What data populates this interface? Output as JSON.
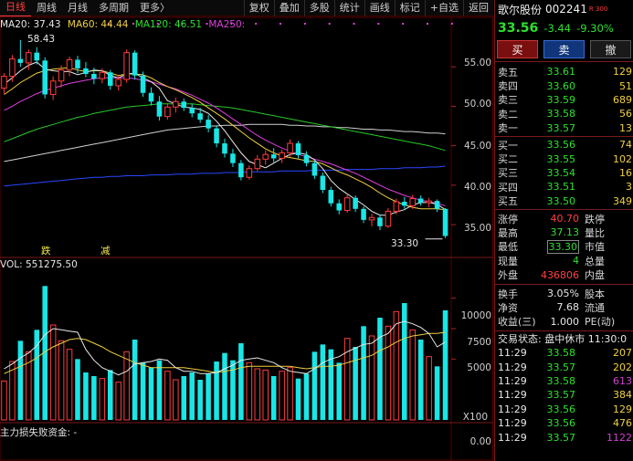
{
  "toolbar": {
    "tabs": [
      "日线",
      "周线",
      "月线",
      "多周期",
      "更多"
    ],
    "more_arrow": "〉",
    "tools": [
      "复权",
      "叠加",
      "多股",
      "统计",
      "画线",
      "标记",
      "+自选",
      "返回"
    ]
  },
  "legend": {
    "ma20": "MA20: 37.43",
    "ma60": "MA60: 44.44",
    "ma120": "MA120: 46.51",
    "ma250": "MA250: 42.42"
  },
  "colors": {
    "up": "#ff3c3c",
    "down": "#19e6e6",
    "ma5": "#e8e8e8",
    "ma10": "#f0d040",
    "ma20": "#e040e0",
    "ma60": "#28c828",
    "ma120": "#d0d0d0",
    "ma250": "#2848ff",
    "grid": "#5a0000"
  },
  "price_axis": {
    "labels": [
      "55.00",
      "50.00",
      "45.00",
      "40.00",
      "35.00"
    ]
  },
  "volume_axis": {
    "labels": [
      "10000",
      "7500",
      "5000"
    ],
    "unit": "X100"
  },
  "funds_axis": {
    "labels": [
      "0.00"
    ]
  },
  "annotations": {
    "high": "58.43",
    "low": "33.30",
    "mark1": "跌",
    "mark2": "减"
  },
  "volume_legend": "VOL: 551275.50",
  "funds_label": "主力损失败资金: -",
  "chart_data": {
    "type": "candlestick",
    "ylim": [
      32,
      60
    ],
    "candles": [
      {
        "o": 52.3,
        "h": 54.2,
        "l": 51.6,
        "c": 53.8
      },
      {
        "o": 53.8,
        "h": 56.5,
        "l": 53.1,
        "c": 56.0
      },
      {
        "o": 56.0,
        "h": 58.4,
        "l": 55.0,
        "c": 55.5
      },
      {
        "o": 55.5,
        "h": 57.2,
        "l": 54.6,
        "c": 56.8
      },
      {
        "o": 56.8,
        "h": 57.5,
        "l": 55.3,
        "c": 55.8
      },
      {
        "o": 55.8,
        "h": 56.2,
        "l": 51.0,
        "c": 51.5
      },
      {
        "o": 51.5,
        "h": 53.8,
        "l": 50.8,
        "c": 53.2
      },
      {
        "o": 53.2,
        "h": 55.2,
        "l": 52.4,
        "c": 54.6
      },
      {
        "o": 54.6,
        "h": 56.3,
        "l": 53.8,
        "c": 55.9
      },
      {
        "o": 55.9,
        "h": 56.4,
        "l": 54.2,
        "c": 54.8
      },
      {
        "o": 54.8,
        "h": 55.6,
        "l": 53.7,
        "c": 54.1
      },
      {
        "o": 54.1,
        "h": 54.9,
        "l": 52.8,
        "c": 53.5
      },
      {
        "o": 53.5,
        "h": 54.8,
        "l": 52.9,
        "c": 54.3
      },
      {
        "o": 54.3,
        "h": 54.6,
        "l": 52.1,
        "c": 52.6
      },
      {
        "o": 52.6,
        "h": 53.9,
        "l": 52.0,
        "c": 53.4
      },
      {
        "o": 53.4,
        "h": 57.2,
        "l": 53.0,
        "c": 56.8
      },
      {
        "o": 56.8,
        "h": 57.1,
        "l": 53.4,
        "c": 53.9
      },
      {
        "o": 53.9,
        "h": 54.4,
        "l": 51.2,
        "c": 51.7
      },
      {
        "o": 51.7,
        "h": 52.4,
        "l": 50.1,
        "c": 50.6
      },
      {
        "o": 50.6,
        "h": 51.3,
        "l": 48.2,
        "c": 48.7
      },
      {
        "o": 48.7,
        "h": 50.4,
        "l": 48.3,
        "c": 49.9
      },
      {
        "o": 49.9,
        "h": 51.1,
        "l": 49.2,
        "c": 50.6
      },
      {
        "o": 50.6,
        "h": 51.0,
        "l": 49.4,
        "c": 49.8
      },
      {
        "o": 49.8,
        "h": 50.3,
        "l": 48.6,
        "c": 49.1
      },
      {
        "o": 49.1,
        "h": 49.8,
        "l": 47.9,
        "c": 48.3
      },
      {
        "o": 48.3,
        "h": 48.9,
        "l": 46.7,
        "c": 47.2
      },
      {
        "o": 47.2,
        "h": 47.6,
        "l": 44.8,
        "c": 45.3
      },
      {
        "o": 45.3,
        "h": 45.9,
        "l": 43.5,
        "c": 44.0
      },
      {
        "o": 44.0,
        "h": 44.6,
        "l": 42.3,
        "c": 42.8
      },
      {
        "o": 42.8,
        "h": 43.2,
        "l": 40.6,
        "c": 41.0
      },
      {
        "o": 41.0,
        "h": 42.5,
        "l": 40.7,
        "c": 42.1
      },
      {
        "o": 42.1,
        "h": 43.8,
        "l": 41.8,
        "c": 43.3
      },
      {
        "o": 43.3,
        "h": 44.4,
        "l": 42.6,
        "c": 43.9
      },
      {
        "o": 43.9,
        "h": 44.7,
        "l": 42.9,
        "c": 43.4
      },
      {
        "o": 43.4,
        "h": 44.5,
        "l": 42.8,
        "c": 44.1
      },
      {
        "o": 44.1,
        "h": 45.8,
        "l": 43.6,
        "c": 45.3
      },
      {
        "o": 45.3,
        "h": 45.6,
        "l": 43.4,
        "c": 43.8
      },
      {
        "o": 43.8,
        "h": 44.3,
        "l": 42.4,
        "c": 42.8
      },
      {
        "o": 42.8,
        "h": 43.1,
        "l": 40.8,
        "c": 41.2
      },
      {
        "o": 41.2,
        "h": 41.6,
        "l": 39.0,
        "c": 39.4
      },
      {
        "o": 39.4,
        "h": 39.8,
        "l": 37.3,
        "c": 37.7
      },
      {
        "o": 37.7,
        "h": 38.2,
        "l": 36.3,
        "c": 36.8
      },
      {
        "o": 36.8,
        "h": 38.9,
        "l": 36.5,
        "c": 38.4
      },
      {
        "o": 38.4,
        "h": 38.7,
        "l": 36.6,
        "c": 37.0
      },
      {
        "o": 37.0,
        "h": 37.3,
        "l": 35.2,
        "c": 35.6
      },
      {
        "o": 35.6,
        "h": 36.4,
        "l": 34.8,
        "c": 35.9
      },
      {
        "o": 35.9,
        "h": 36.3,
        "l": 34.3,
        "c": 34.8
      },
      {
        "o": 34.8,
        "h": 37.1,
        "l": 34.6,
        "c": 36.7
      },
      {
        "o": 36.7,
        "h": 38.3,
        "l": 36.3,
        "c": 37.9
      },
      {
        "o": 37.9,
        "h": 38.5,
        "l": 37.0,
        "c": 37.4
      },
      {
        "o": 37.4,
        "h": 38.8,
        "l": 37.0,
        "c": 38.3
      },
      {
        "o": 38.3,
        "h": 38.7,
        "l": 37.4,
        "c": 37.8
      },
      {
        "o": 37.8,
        "h": 38.4,
        "l": 37.2,
        "c": 38.0
      },
      {
        "o": 38.0,
        "h": 38.2,
        "l": 36.6,
        "c": 37.0
      },
      {
        "o": 37.0,
        "h": 37.1,
        "l": 33.3,
        "c": 33.56
      }
    ],
    "ma5": [
      52.8,
      53.6,
      54.5,
      55.2,
      55.6,
      54.7,
      54.5,
      54.4,
      54.4,
      54.0,
      54.3,
      54.6,
      54.5,
      53.9,
      53.6,
      54.1,
      54.2,
      53.6,
      53.1,
      52.3,
      50.7,
      50.3,
      49.9,
      49.8,
      49.6,
      49.1,
      48.1,
      46.9,
      45.5,
      44.1,
      43.0,
      42.6,
      42.2,
      42.8,
      43.4,
      43.9,
      44.1,
      43.9,
      43.2,
      42.1,
      40.6,
      39.6,
      38.9,
      38.2,
      37.5,
      36.7,
      36.2,
      36.2,
      36.6,
      36.9,
      37.5,
      37.8,
      37.8,
      37.6,
      36.9
    ],
    "ma10": [
      51.5,
      52.2,
      53.0,
      53.6,
      54.2,
      54.5,
      54.7,
      54.8,
      54.9,
      54.6,
      54.4,
      54.5,
      54.5,
      54.2,
      53.9,
      54.1,
      54.1,
      54.0,
      53.6,
      53.0,
      52.5,
      52.1,
      51.6,
      51.1,
      50.5,
      49.8,
      49.1,
      48.4,
      47.6,
      46.8,
      46.0,
      45.3,
      44.6,
      44.1,
      43.7,
      43.5,
      43.3,
      43.1,
      43.0,
      42.7,
      42.2,
      41.7,
      41.3,
      40.8,
      40.3,
      39.7,
      39.0,
      38.4,
      37.9,
      37.5,
      37.2,
      37.0,
      37.0,
      37.0,
      36.9
    ],
    "ma20": [
      49.5,
      50.0,
      50.6,
      51.1,
      51.6,
      52.0,
      52.3,
      52.6,
      52.9,
      53.1,
      53.3,
      53.5,
      53.6,
      53.6,
      53.6,
      53.6,
      53.5,
      53.3,
      53.1,
      52.8,
      52.5,
      52.2,
      51.8,
      51.4,
      50.9,
      50.4,
      49.8,
      49.1,
      48.4,
      47.7,
      47.0,
      46.3,
      45.7,
      45.2,
      44.7,
      44.3,
      43.9,
      43.6,
      43.3,
      43.0,
      42.7,
      42.3,
      41.9,
      41.5,
      41.0,
      40.5,
      40.0,
      39.5,
      39.1,
      38.7,
      38.4,
      38.1,
      37.9,
      37.7,
      37.4
    ],
    "ma60": [
      45.5,
      45.9,
      46.3,
      46.7,
      47.1,
      47.4,
      47.7,
      48.0,
      48.3,
      48.6,
      48.8,
      49.1,
      49.3,
      49.5,
      49.7,
      49.9,
      50.0,
      50.1,
      50.2,
      50.3,
      50.3,
      50.3,
      50.3,
      50.3,
      50.2,
      50.1,
      50.0,
      49.9,
      49.8,
      49.6,
      49.4,
      49.2,
      49.0,
      48.8,
      48.6,
      48.4,
      48.2,
      48.0,
      47.8,
      47.6,
      47.4,
      47.2,
      47.0,
      46.8,
      46.6,
      46.4,
      46.2,
      46.0,
      45.8,
      45.6,
      45.4,
      45.2,
      45.0,
      44.7,
      44.4
    ],
    "ma120": [
      43.0,
      43.2,
      43.4,
      43.6,
      43.8,
      44.0,
      44.2,
      44.4,
      44.6,
      44.8,
      45.0,
      45.2,
      45.4,
      45.6,
      45.8,
      46.0,
      46.2,
      46.4,
      46.6,
      46.8,
      47.0,
      47.1,
      47.2,
      47.3,
      47.4,
      47.5,
      47.5,
      47.6,
      47.6,
      47.6,
      47.7,
      47.7,
      47.7,
      47.7,
      47.7,
      47.6,
      47.6,
      47.5,
      47.5,
      47.4,
      47.4,
      47.3,
      47.3,
      47.2,
      47.1,
      47.1,
      47.0,
      47.0,
      46.9,
      46.8,
      46.8,
      46.7,
      46.6,
      46.6,
      46.51
    ],
    "ma250": [
      39.9,
      40.0,
      40.1,
      40.2,
      40.3,
      40.4,
      40.5,
      40.6,
      40.7,
      40.8,
      40.9,
      41.0,
      41.0,
      41.1,
      41.1,
      41.2,
      41.2,
      41.2,
      41.3,
      41.3,
      41.3,
      41.4,
      41.4,
      41.4,
      41.5,
      41.5,
      41.5,
      41.6,
      41.6,
      41.6,
      41.7,
      41.7,
      41.7,
      41.7,
      41.8,
      41.8,
      41.8,
      41.8,
      41.9,
      41.9,
      41.9,
      41.9,
      42.0,
      42.0,
      42.0,
      42.0,
      42.1,
      42.1,
      42.1,
      42.2,
      42.2,
      42.2,
      42.3,
      42.3,
      42.42
    ],
    "volume_ylim": [
      0,
      12000
    ],
    "volumes": [
      3200,
      4800,
      6500,
      5600,
      7400,
      11000,
      7800,
      6500,
      5800,
      5000,
      3900,
      3600,
      3400,
      4100,
      3100,
      5600,
      6600,
      4700,
      4300,
      4900,
      4000,
      3300,
      3600,
      3900,
      3300,
      3800,
      4800,
      5500,
      4900,
      6300,
      4700,
      4200,
      4100,
      3600,
      4000,
      4300,
      3400,
      3800,
      5600,
      6200,
      5800,
      4700,
      6700,
      6000,
      7700,
      6900,
      8400,
      7700,
      8900,
      9600,
      7400,
      6600,
      5200,
      4400,
      9000
    ],
    "vol_ma5": [
      4200,
      4600,
      5100,
      5500,
      6100,
      7000,
      7500,
      7400,
      7300,
      7200,
      5800,
      4900,
      4300,
      4000,
      3700,
      4000,
      4600,
      4700,
      4800,
      5000,
      4900,
      4300,
      4000,
      4000,
      3800,
      3800,
      3900,
      4200,
      4500,
      4900,
      5000,
      5100,
      4900,
      4700,
      4300,
      4000,
      3900,
      3800,
      4200,
      4700,
      5000,
      5200,
      5600,
      5900,
      6200,
      6300,
      6800,
      7100,
      7900,
      8100,
      7900,
      7600,
      7100,
      6000,
      6400
    ],
    "vol_ma10": [
      3800,
      4100,
      4400,
      4700,
      5100,
      5600,
      6000,
      6300,
      6600,
      6700,
      6600,
      6300,
      6000,
      5600,
      5300,
      5000,
      4700,
      4500,
      4300,
      4300,
      4300,
      4300,
      4300,
      4200,
      4100,
      4000,
      3900,
      4000,
      4100,
      4300,
      4400,
      4400,
      4400,
      4400,
      4400,
      4400,
      4300,
      4200,
      4300,
      4400,
      4400,
      4500,
      4700,
      4900,
      5100,
      5300,
      5700,
      6000,
      6400,
      6700,
      6900,
      7000,
      7100,
      7100,
      7200
    ]
  },
  "quote": {
    "name": "歌尔股份",
    "code": "002241",
    "tag": "R 300",
    "price": "33.56",
    "change": "-3.44",
    "pct": "-9.30%",
    "buy_btn": "买",
    "sell_btn": "卖",
    "cancel_btn": "撤"
  },
  "asks": [
    {
      "label": "卖五",
      "price": "33.61",
      "vol": "129"
    },
    {
      "label": "卖四",
      "price": "33.60",
      "vol": "51"
    },
    {
      "label": "卖三",
      "price": "33.59",
      "vol": "689"
    },
    {
      "label": "卖二",
      "price": "33.58",
      "vol": "56"
    },
    {
      "label": "卖一",
      "price": "33.57",
      "vol": "13"
    }
  ],
  "bids": [
    {
      "label": "买一",
      "price": "33.56",
      "vol": "74"
    },
    {
      "label": "买二",
      "price": "33.55",
      "vol": "102"
    },
    {
      "label": "买三",
      "price": "33.54",
      "vol": "16"
    },
    {
      "label": "买四",
      "price": "33.51",
      "vol": "3"
    },
    {
      "label": "买五",
      "price": "33.50",
      "vol": "349"
    }
  ],
  "summary": [
    {
      "k1": "涨停",
      "v1": "40.70",
      "k2": "跌停"
    },
    {
      "k1": "最高",
      "v1": "37.13",
      "k2": "量比"
    },
    {
      "k1": "最低",
      "v1": "33.30",
      "k2": "市值"
    },
    {
      "k1": "现量",
      "v1": "4",
      "k2": "总量"
    },
    {
      "k1": "外盘",
      "v1": "436806",
      "k2": "内盘"
    }
  ],
  "stats": [
    {
      "k1": "换手",
      "v1": "3.05%",
      "k2": "股本"
    },
    {
      "k1": "净资",
      "v1": "7.68",
      "k2": "流通"
    },
    {
      "k1": "收益(三)",
      "v1": "1.000",
      "k2": "PE(动)"
    }
  ],
  "status": "交易状态: 盘中休市 11:30:0",
  "ticks": [
    {
      "t": "11:29",
      "p": "33.58",
      "v": "207"
    },
    {
      "t": "11:29",
      "p": "33.57",
      "v": "202"
    },
    {
      "t": "11:29",
      "p": "33.58",
      "v": "613"
    },
    {
      "t": "11:29",
      "p": "33.57",
      "v": "384"
    },
    {
      "t": "11:29",
      "p": "33.56",
      "v": "129"
    },
    {
      "t": "11:29",
      "p": "33.56",
      "v": "476"
    },
    {
      "t": "11:29",
      "p": "33.57",
      "v": "1122"
    }
  ]
}
